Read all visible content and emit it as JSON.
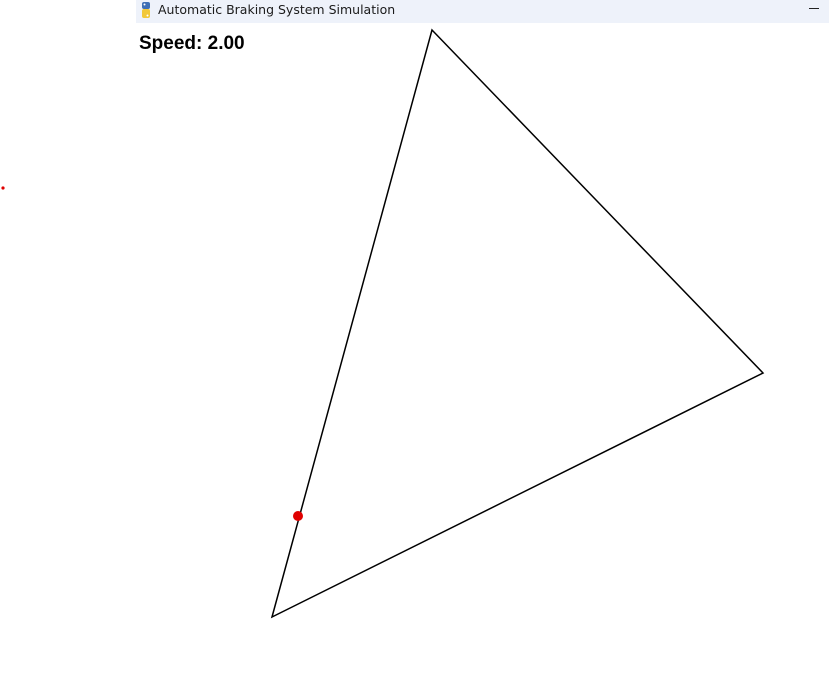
{
  "window": {
    "title": "Automatic Braking System Simulation",
    "app_icon": "python-icon",
    "minimize_icon": "minimize-icon"
  },
  "hud": {
    "speed_text": "Speed: 2.00"
  },
  "colors": {
    "track": "#000000",
    "vehicle": "#e00000",
    "titlebar": "#eef2fa",
    "background": "#ffffff"
  }
}
